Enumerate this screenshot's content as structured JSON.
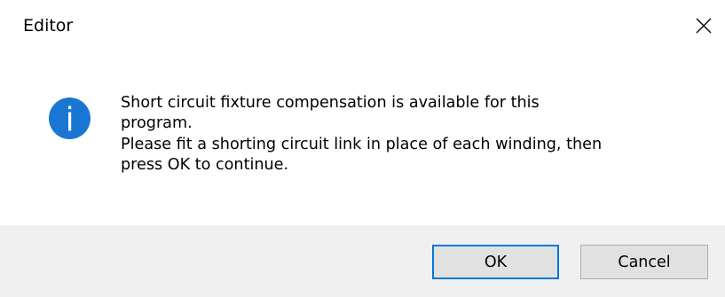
{
  "window": {
    "title": "Editor",
    "close_icon": "close-icon"
  },
  "message": {
    "icon": "info-icon",
    "icon_color": "#1976d2",
    "lines": [
      "Short circuit fixture compensation is available for this",
      "program.",
      "Please fit a shorting circuit link in place of each winding, then",
      "press OK to continue."
    ]
  },
  "buttons": {
    "ok_label": "OK",
    "cancel_label": "Cancel",
    "default_focus_color": "#0078d7"
  },
  "colors": {
    "dialog_background": "#ffffff",
    "footer_background": "#f0f0f0",
    "button_background": "#e1e1e1",
    "button_border": "#adadad"
  }
}
